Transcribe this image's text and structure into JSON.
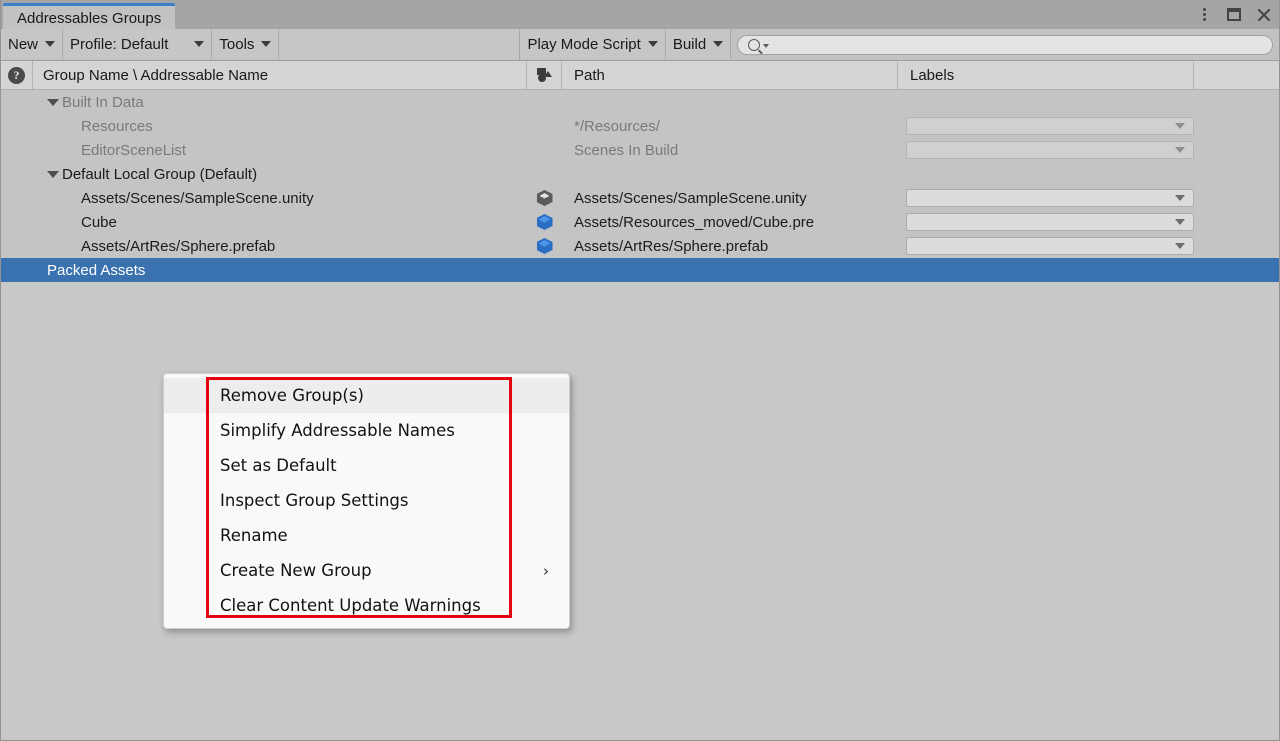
{
  "window": {
    "tab_title": "Addressables Groups",
    "controls": {
      "menu": "kebab-menu",
      "maximize": "maximize",
      "close": "close"
    }
  },
  "toolbar": {
    "new_label": "New",
    "profile_label": "Profile: Default",
    "tools_label": "Tools",
    "play_mode_script_label": "Play Mode Script",
    "build_label": "Build",
    "search_placeholder": "",
    "search_value": ""
  },
  "columns": {
    "help": "?",
    "group_name": "Group Name \\ Addressable Name",
    "bundle_icon": "bundle-icon",
    "path": "Path",
    "labels": "Labels"
  },
  "tree": {
    "rows": [
      {
        "name": "Built In Data",
        "type": "group",
        "expanded": true,
        "dim": true,
        "icon": "",
        "path": "",
        "has_label_combo": false
      },
      {
        "name": "Resources",
        "type": "entry",
        "dim": true,
        "icon": "",
        "path": "*/Resources/",
        "has_label_combo": true
      },
      {
        "name": "EditorSceneList",
        "type": "entry",
        "dim": true,
        "icon": "",
        "path": "Scenes In Build",
        "has_label_combo": true
      },
      {
        "name": "Default Local Group (Default)",
        "type": "group",
        "expanded": true,
        "dim": false,
        "icon": "",
        "path": "",
        "has_label_combo": false
      },
      {
        "name": "Assets/Scenes/SampleScene.unity",
        "type": "entry",
        "dim": false,
        "icon": "scene-icon",
        "path": "Assets/Scenes/SampleScene.unity",
        "has_label_combo": true
      },
      {
        "name": "Cube",
        "type": "entry",
        "dim": false,
        "icon": "prefab-icon",
        "path": "Assets/Resources_moved/Cube.pre",
        "has_label_combo": true
      },
      {
        "name": "Assets/ArtRes/Sphere.prefab",
        "type": "entry",
        "dim": false,
        "icon": "prefab-icon",
        "path": "Assets/ArtRes/Sphere.prefab",
        "has_label_combo": true
      },
      {
        "name": "Packed Assets",
        "type": "group",
        "expanded": false,
        "dim": false,
        "selected": true,
        "icon": "",
        "path": "",
        "has_label_combo": false
      }
    ]
  },
  "context_menu": {
    "items": [
      {
        "label": "Remove Group(s)",
        "highlighted": true,
        "submenu": false
      },
      {
        "label": "Simplify Addressable Names",
        "highlighted": false,
        "submenu": false
      },
      {
        "label": "Set as Default",
        "highlighted": false,
        "submenu": false
      },
      {
        "label": "Inspect Group Settings",
        "highlighted": false,
        "submenu": false
      },
      {
        "label": "Rename",
        "highlighted": false,
        "submenu": false
      },
      {
        "label": "Create New Group",
        "highlighted": false,
        "submenu": true,
        "submenu_glyph": "›"
      },
      {
        "label": "Clear Content Update Warnings",
        "highlighted": false,
        "submenu": false
      }
    ]
  },
  "annotation": {
    "color": "#e60012"
  }
}
